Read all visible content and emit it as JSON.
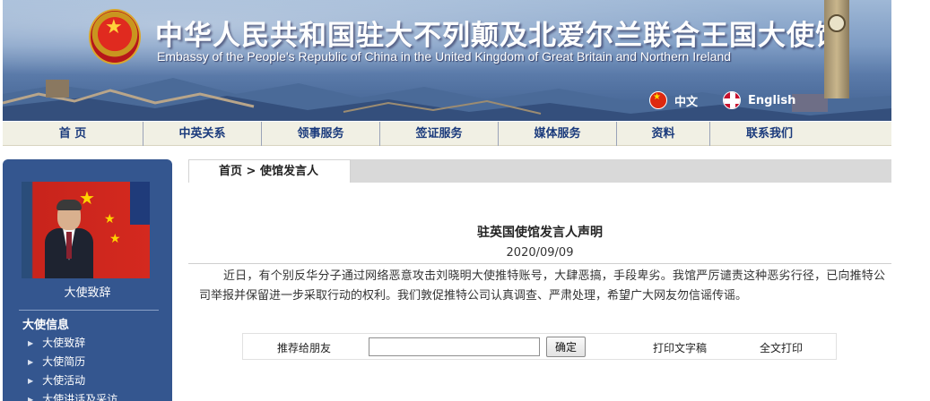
{
  "header": {
    "title_cn": "中华人民共和国驻大不列颠及北爱尔兰联合王国大使馆",
    "title_en": "Embassy of the People's Republic of China in the United Kingdom of Great Britain and Northern Ireland",
    "lang_cn": "中文",
    "lang_en": "English"
  },
  "nav": {
    "items": [
      {
        "label": "首 页"
      },
      {
        "label": "中英关系"
      },
      {
        "label": "领事服务"
      },
      {
        "label": "签证服务"
      },
      {
        "label": "媒体服务"
      },
      {
        "label": "资料"
      },
      {
        "label": "联系我们"
      }
    ]
  },
  "sidebar": {
    "caption": "大使致辞",
    "section_title": "大使信息",
    "items": [
      {
        "label": "大使致辞"
      },
      {
        "label": "大使简历"
      },
      {
        "label": "大使活动"
      },
      {
        "label": "大使讲话及采访"
      }
    ]
  },
  "breadcrumb": {
    "home": "首页",
    "sep": ">",
    "current": "使馆发言人"
  },
  "article": {
    "title": "驻英国使馆发言人声明",
    "date": "2020/09/09",
    "body": "近日，有个别反华分子通过网络恶意攻击刘晓明大使推特账号，大肆恶搞，手段卑劣。我馆严厉谴责这种恶劣行径，已向推特公司举报并保留进一步采取行动的权利。我们敦促推特公司认真调查、严肃处理，希望广大网友勿信谣传谣。"
  },
  "actions": {
    "recommend_label": "推荐给朋友",
    "recommend_value": "",
    "confirm_label": "确定",
    "print_text": "打印文字稿",
    "print_all": "全文打印"
  },
  "colors": {
    "sidebar_bg": "#34568f",
    "nav_bg": "#f1f0e4",
    "nav_text": "#1a3a7c"
  }
}
